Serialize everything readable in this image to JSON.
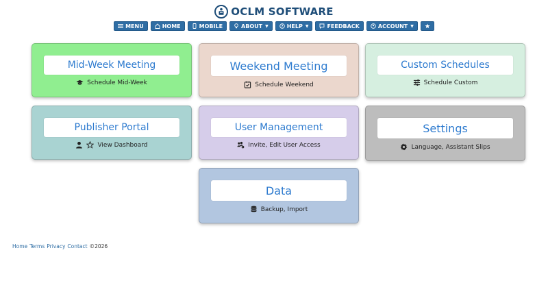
{
  "brand": {
    "title": "OCLM SOFTWARE",
    "logo_icon": "podium-speaker-icon"
  },
  "nav": {
    "menu": "MENU",
    "home": "HOME",
    "mobile": "MOBILE",
    "about": "ABOUT",
    "help": "HELP",
    "feedback": "FEEDBACK",
    "account": "ACCOUNT"
  },
  "cards": {
    "midweek": {
      "title": "Mid-Week Meeting",
      "sub": "Schedule Mid-Week",
      "color": "#90ee90"
    },
    "weekend": {
      "title": "Weekend Meeting",
      "sub": "Schedule Weekend",
      "color": "#ebd7cd"
    },
    "custom": {
      "title": "Custom Schedules",
      "sub": "Schedule Custom",
      "color": "#d6efe0"
    },
    "publisher": {
      "title": "Publisher Portal",
      "sub": "View Dashboard",
      "color": "#a9d3d2"
    },
    "users": {
      "title": "User Management",
      "sub": "Invite, Edit User Access",
      "color": "#d6cdea"
    },
    "settings": {
      "title": "Settings",
      "sub": "Language, Assistant Slips",
      "color": "#bdbdbd"
    },
    "data": {
      "title": "Data",
      "sub": "Backup, Import",
      "color": "#b2c6e0"
    }
  },
  "footer": {
    "home": "Home",
    "terms": "Terms",
    "privacy": "Privacy",
    "contact": "Contact",
    "copyright": "©2026"
  },
  "colors": {
    "nav_bg": "#2e6da4",
    "brand": "#1f4e79",
    "title_text": "#2e7bcf"
  }
}
